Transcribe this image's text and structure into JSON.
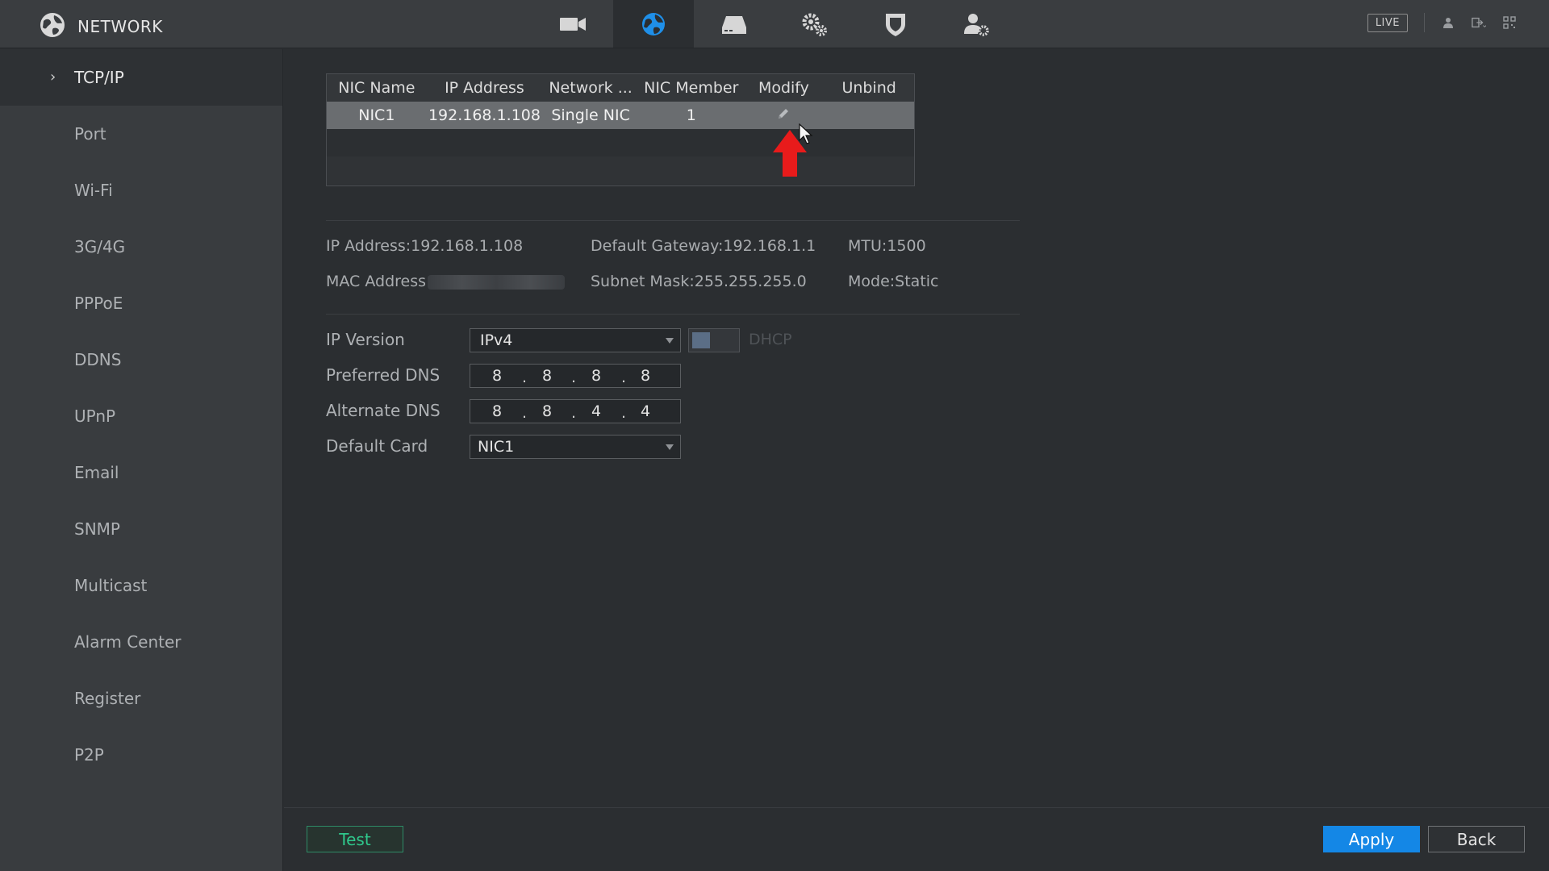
{
  "header": {
    "title": "NETWORK",
    "nav_icons": [
      "camera-icon",
      "network-globe-icon",
      "storage-icon",
      "system-settings-icon",
      "security-shield-icon",
      "account-icon"
    ],
    "active_nav": "network-globe-icon",
    "live_label": "LIVE",
    "accent_color": "#1487e6"
  },
  "sidebar": {
    "items": [
      {
        "label": "TCP/IP"
      },
      {
        "label": "Port"
      },
      {
        "label": "Wi-Fi"
      },
      {
        "label": "3G/4G"
      },
      {
        "label": "PPPoE"
      },
      {
        "label": "DDNS"
      },
      {
        "label": "UPnP"
      },
      {
        "label": "Email"
      },
      {
        "label": "SNMP"
      },
      {
        "label": "Multicast"
      },
      {
        "label": "Alarm Center"
      },
      {
        "label": "Register"
      },
      {
        "label": "P2P"
      }
    ],
    "active": "TCP/IP"
  },
  "nic_table": {
    "columns": [
      "NIC Name",
      "IP Address",
      "Network ...",
      "NIC Member",
      "Modify",
      "Unbind"
    ],
    "rows": [
      {
        "nic_name": "NIC1",
        "ip": "192.168.1.108",
        "network": "Single NIC",
        "member": "1"
      }
    ]
  },
  "info": {
    "ip_label": "IP Address:",
    "ip_value": "192.168.1.108",
    "gateway_label": "Default Gateway:",
    "gateway_value": "192.168.1.1",
    "mtu_label": "MTU:",
    "mtu_value": "1500",
    "mac_label": "MAC Address",
    "subnet_label": "Subnet Mask:",
    "subnet_value": "255.255.255.0",
    "mode_label": "Mode:",
    "mode_value": "Static"
  },
  "form": {
    "ip_version_label": "IP Version",
    "ip_version_value": "IPv4",
    "dhcp_label": "DHCP",
    "preferred_dns_label": "Preferred DNS",
    "preferred_dns": [
      "8",
      "8",
      "8",
      "8"
    ],
    "alternate_dns_label": "Alternate DNS",
    "alternate_dns": [
      "8",
      "8",
      "4",
      "4"
    ],
    "default_card_label": "Default Card",
    "default_card_value": "NIC1"
  },
  "footer": {
    "test_label": "Test",
    "apply_label": "Apply",
    "back_label": "Back"
  }
}
